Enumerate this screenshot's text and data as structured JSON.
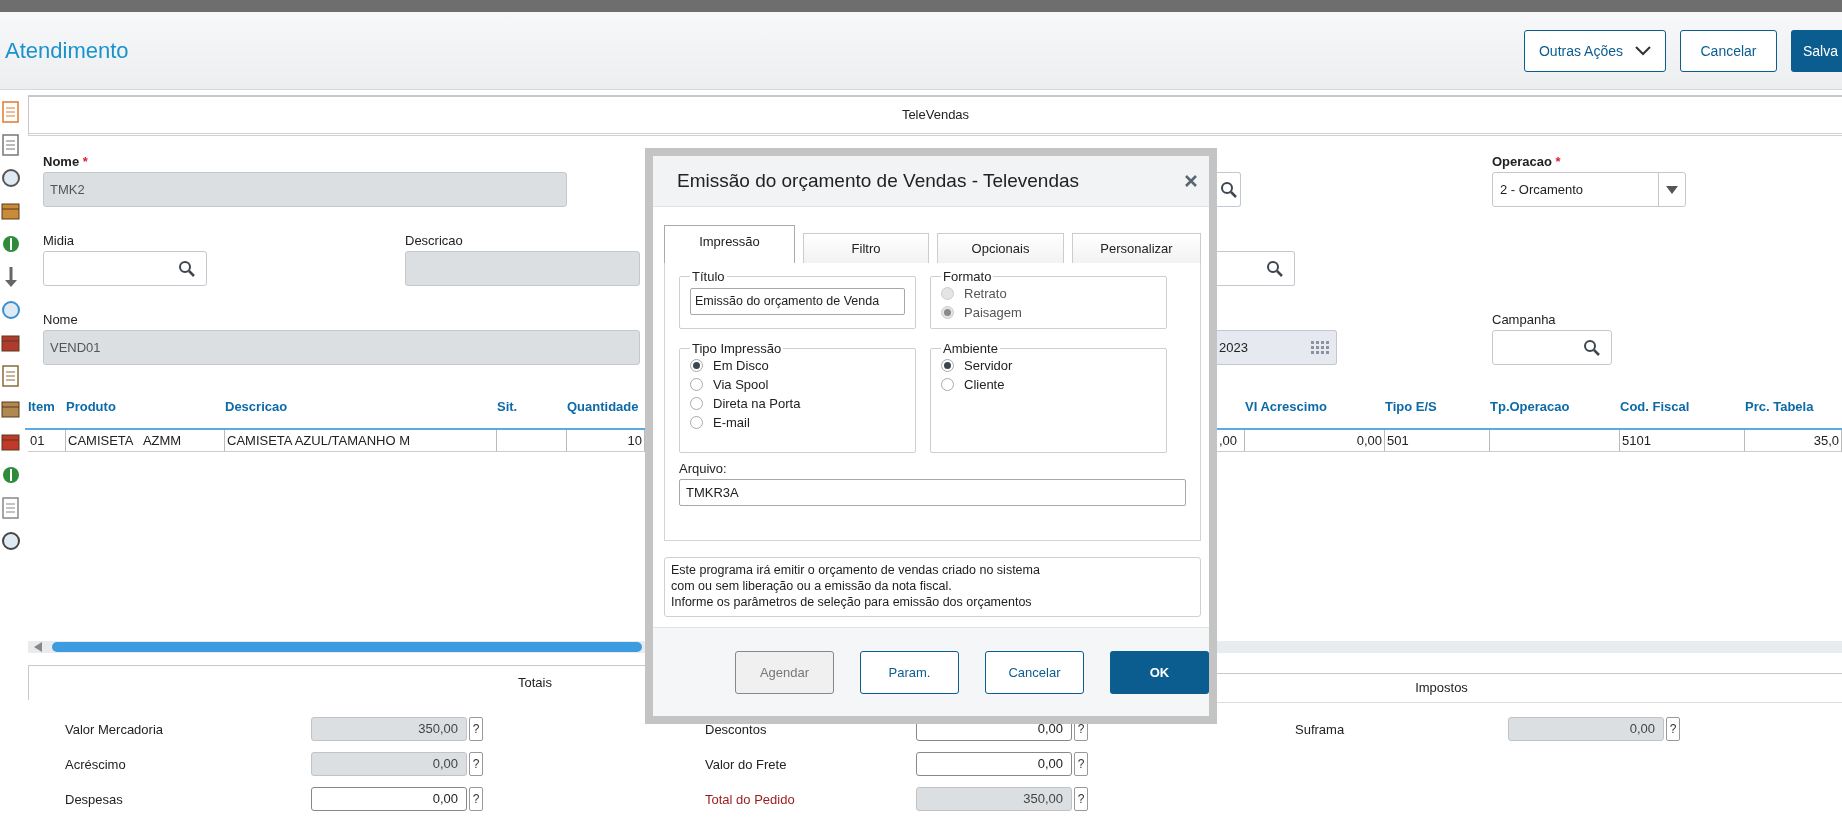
{
  "header": {
    "title": "Atendimento",
    "buttons": [
      {
        "label": "Outras Ações",
        "kind": "menu"
      },
      {
        "label": "Cancelar",
        "kind": "outline"
      },
      {
        "label": "Salva",
        "kind": "primary"
      }
    ]
  },
  "form_tab": {
    "label": "TeleVendas"
  },
  "form": {
    "nome": {
      "label": "Nome",
      "marker": "*",
      "value": "TMK2",
      "disabled": true
    },
    "operacao": {
      "label": "Operacao",
      "marker": "*",
      "value": "2 - Orcamento"
    },
    "midia": {
      "label": "Midia",
      "disabled": false
    },
    "descricao": {
      "label": "Descricao",
      "disabled": true
    },
    "vendedor": {
      "label": "Nome",
      "value": "VEND01",
      "disabled": true
    },
    "field_3": {
      "value": "2023"
    },
    "campanha": {
      "label": "Campanha",
      "disabled": false
    }
  },
  "table": {
    "columns": [
      {
        "label": "Item"
      },
      {
        "label": "Produto"
      },
      {
        "label": "Descricao"
      },
      {
        "label": "Sit."
      },
      {
        "label": "Quantidade"
      },
      {},
      {
        "label": "VI Acrescimo"
      },
      {
        "label": "Tipo E/S"
      },
      {
        "label": "Tp.Operacao"
      },
      {
        "label": "Cod. Fiscal"
      },
      {
        "label": "Prc. Tabela"
      }
    ],
    "rows": [
      {
        "selected": true,
        "cells": [
          {
            "text": "01"
          },
          {
            "text": "CAMISETA   AZMM"
          },
          {
            "text": "CAMISETA AZUL/TAMANHO M"
          },
          {},
          {
            "text": "10"
          },
          {
            "text": ",00"
          },
          {
            "text": "0,00"
          },
          {
            "text": "501"
          },
          {},
          {
            "text": "5101"
          },
          {
            "text": "35,0"
          }
        ]
      }
    ]
  },
  "totals": {
    "title": "Totais",
    "columns": [
      [
        {
          "label": "Valor Mercadoria",
          "value": "350,00",
          "disabled": true,
          "emphasis": false,
          "help": "?"
        },
        {
          "label": "Acréscimo",
          "value": "0,00",
          "disabled": true,
          "emphasis": false,
          "help": "?"
        },
        {
          "label": "Despesas",
          "value": "0,00",
          "disabled": false,
          "emphasis": false,
          "help": "?"
        }
      ],
      [
        {
          "label": "Descontos",
          "value": "0,00",
          "disabled": false,
          "emphasis": false,
          "help": "?"
        },
        {
          "label": "Valor do Frete",
          "value": "0,00",
          "disabled": false,
          "emphasis": false,
          "help": "?"
        },
        {
          "label": "Total do Pedido",
          "value": "350,00",
          "disabled": true,
          "emphasis": true,
          "help": "?"
        }
      ]
    ]
  },
  "taxes": {
    "title": "Impostos",
    "fields": [
      {
        "label": "Suframa",
        "value": "0,00",
        "disabled": true,
        "emphasis": false,
        "help": "?"
      }
    ]
  },
  "dialog": {
    "title": "Emissão do orçamento de Vendas - Televendas",
    "tabs": [
      {
        "label": "Impressão",
        "selected": true
      },
      {
        "label": "Filtro",
        "selected": false
      },
      {
        "label": "Opcionais",
        "selected": false
      },
      {
        "label": "Personalizar",
        "selected": false
      }
    ],
    "title_group": {
      "legend": "Título",
      "value": "Emissão do orçamento de Venda"
    },
    "format_group": {
      "legend": "Formato",
      "disabled": true,
      "options": [
        {
          "label": "Retrato",
          "selected": false
        },
        {
          "label": "Paisagem",
          "selected": true
        }
      ]
    },
    "print_type_group": {
      "legend": "Tipo Impressão",
      "disabled": false,
      "options": [
        {
          "label": "Em Disco",
          "selected": true
        },
        {
          "label": "Via Spool",
          "selected": false
        },
        {
          "label": "Direta na Porta",
          "selected": false
        },
        {
          "label": "E-mail",
          "selected": false
        }
      ]
    },
    "environment_group": {
      "legend": "Ambiente",
      "disabled": false,
      "options": [
        {
          "label": "Servidor",
          "selected": true
        },
        {
          "label": "Cliente",
          "selected": false
        }
      ]
    },
    "file": {
      "label": "Arquivo:",
      "value": "TMKR3A"
    },
    "description": "Este programa irá emitir o orçamento de vendas criado no sistema\ncom ou sem liberação ou a emissão da nota fiscal.\nInforme os parâmetros de seleção para emissão dos orçamentos",
    "buttons": [
      {
        "label": "Agendar",
        "kind": "secondary",
        "disabled": true
      },
      {
        "label": "Param.",
        "kind": "secondary",
        "disabled": false
      },
      {
        "label": "Cancelar",
        "kind": "secondary",
        "disabled": false
      },
      {
        "label": "OK",
        "kind": "primary",
        "disabled": false
      }
    ]
  }
}
